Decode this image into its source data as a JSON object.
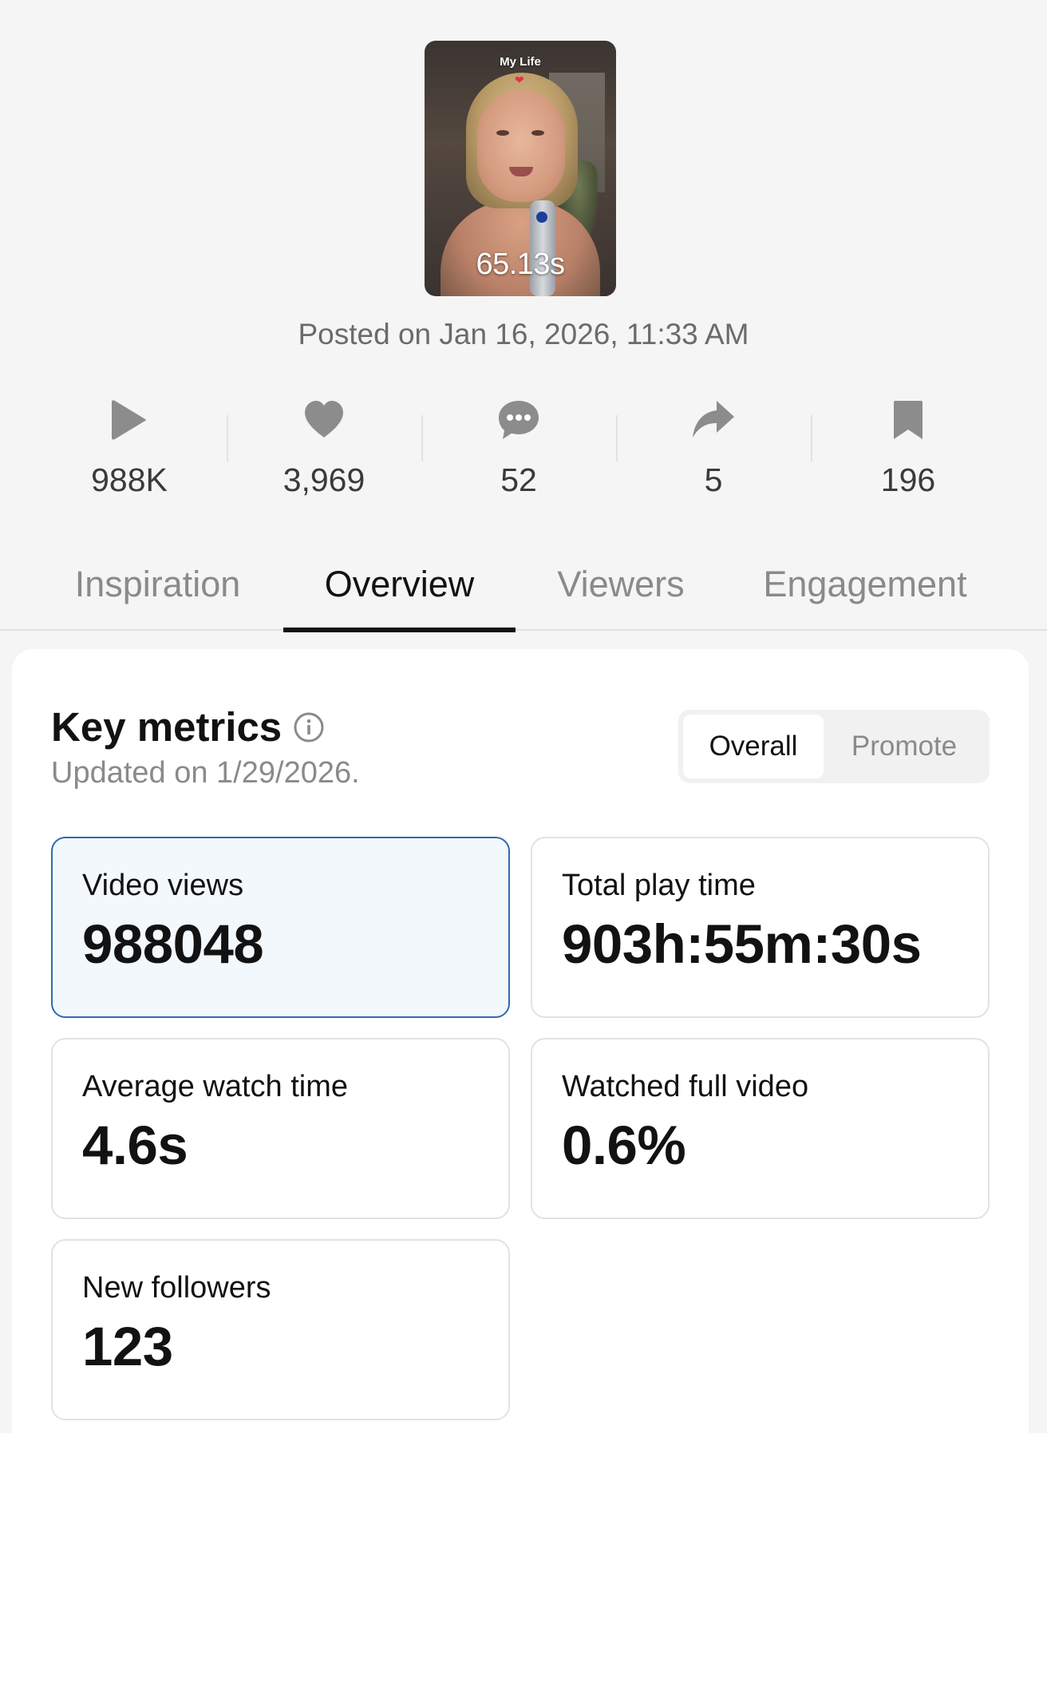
{
  "video": {
    "thumbnail_title": "My Life",
    "duration": "65.13s",
    "posted": "Posted on Jan 16, 2026, 11:33 AM"
  },
  "stats": [
    {
      "icon": "play-icon",
      "value": "988K"
    },
    {
      "icon": "heart-icon",
      "value": "3,969"
    },
    {
      "icon": "comment-icon",
      "value": "52"
    },
    {
      "icon": "share-icon",
      "value": "5"
    },
    {
      "icon": "bookmark-icon",
      "value": "196"
    }
  ],
  "tabs": [
    {
      "label": "Inspiration",
      "active": false
    },
    {
      "label": "Overview",
      "active": true
    },
    {
      "label": "Viewers",
      "active": false
    },
    {
      "label": "Engagement",
      "active": false
    }
  ],
  "key_metrics": {
    "title": "Key metrics",
    "updated": "Updated on 1/29/2026.",
    "toggle": {
      "selected": "Overall",
      "other": "Promote"
    },
    "cards": [
      {
        "label": "Video views",
        "value": "988048",
        "selected": true
      },
      {
        "label": "Total play time",
        "value": "903h:55m:30s",
        "selected": false
      },
      {
        "label": "Average watch time",
        "value": "4.6s",
        "selected": false
      },
      {
        "label": "Watched full video",
        "value": "0.6%",
        "selected": false
      },
      {
        "label": "New followers",
        "value": "123",
        "selected": false
      }
    ]
  },
  "colors": {
    "background": "#f5f5f5",
    "card": "#ffffff",
    "selected_border": "#2c6bb0",
    "selected_fill": "#f3f8fd",
    "icon_gray": "#8c8c8c",
    "muted_text": "#8a8a8a"
  }
}
